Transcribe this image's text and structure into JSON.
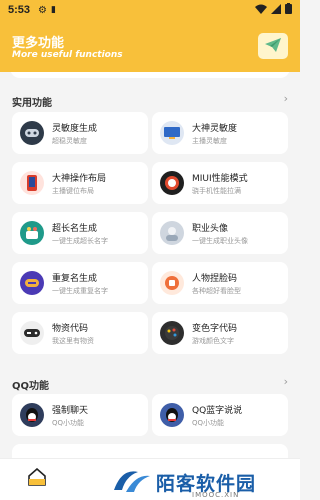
{
  "status_bar": {
    "time": "5:53",
    "icons": [
      "gear-icon",
      "phone-icon",
      "wifi-icon",
      "signal-icon",
      "battery-icon"
    ]
  },
  "header": {
    "title": "更多功能",
    "subtitle": "More useful functions",
    "action_icon": "send-icon"
  },
  "sections": [
    {
      "title": "实用功能",
      "items": [
        {
          "title": "灵敏度生成",
          "desc": "超稳灵敏度",
          "icon": "controller-icon",
          "color": "#2e3a49"
        },
        {
          "title": "大神灵敏度",
          "desc": "主播灵敏度",
          "icon": "monitor-icon",
          "color": "#2f69c7"
        },
        {
          "title": "大神操作布局",
          "desc": "主播键位布局",
          "icon": "phone-icon",
          "color": "#d93c2b"
        },
        {
          "title": "MIUI性能模式",
          "desc": "骁手机性能拉满",
          "icon": "speed-icon",
          "color": "#1f1f1f"
        },
        {
          "title": "超长名生成",
          "desc": "一键生成超长名字",
          "icon": "name-icon",
          "color": "#1f9a8a"
        },
        {
          "title": "职业头像",
          "desc": "一键生成职业头像",
          "icon": "avatar-icon",
          "color": "#cfd6df"
        },
        {
          "title": "重复名生成",
          "desc": "一键生成重复名字",
          "icon": "repeat-icon",
          "color": "#4b3ab5"
        },
        {
          "title": "人物捏脸码",
          "desc": "各种超好看脸型",
          "icon": "face-icon",
          "color": "#ef6f3a"
        },
        {
          "title": "物资代码",
          "desc": "我这里有物资",
          "icon": "gamepad-icon",
          "color": "#efefef"
        },
        {
          "title": "变色字代码",
          "desc": "游戏颜色文字",
          "icon": "palette-icon",
          "color": "#2e2e2e"
        }
      ]
    },
    {
      "title": "QQ功能",
      "items": [
        {
          "title": "强制聊天",
          "desc": "QQ小功能",
          "icon": "qq-icon",
          "color": "#2f3d5c"
        },
        {
          "title": "QQ蓝字说说",
          "desc": "QQ小功能",
          "icon": "qq-icon",
          "color": "#3f5ea8"
        }
      ]
    }
  ],
  "bottom_nav": {
    "home_icon": "home-icon"
  },
  "watermark": {
    "text": "陌客软件园",
    "sub": "IMOOC.XIN"
  }
}
